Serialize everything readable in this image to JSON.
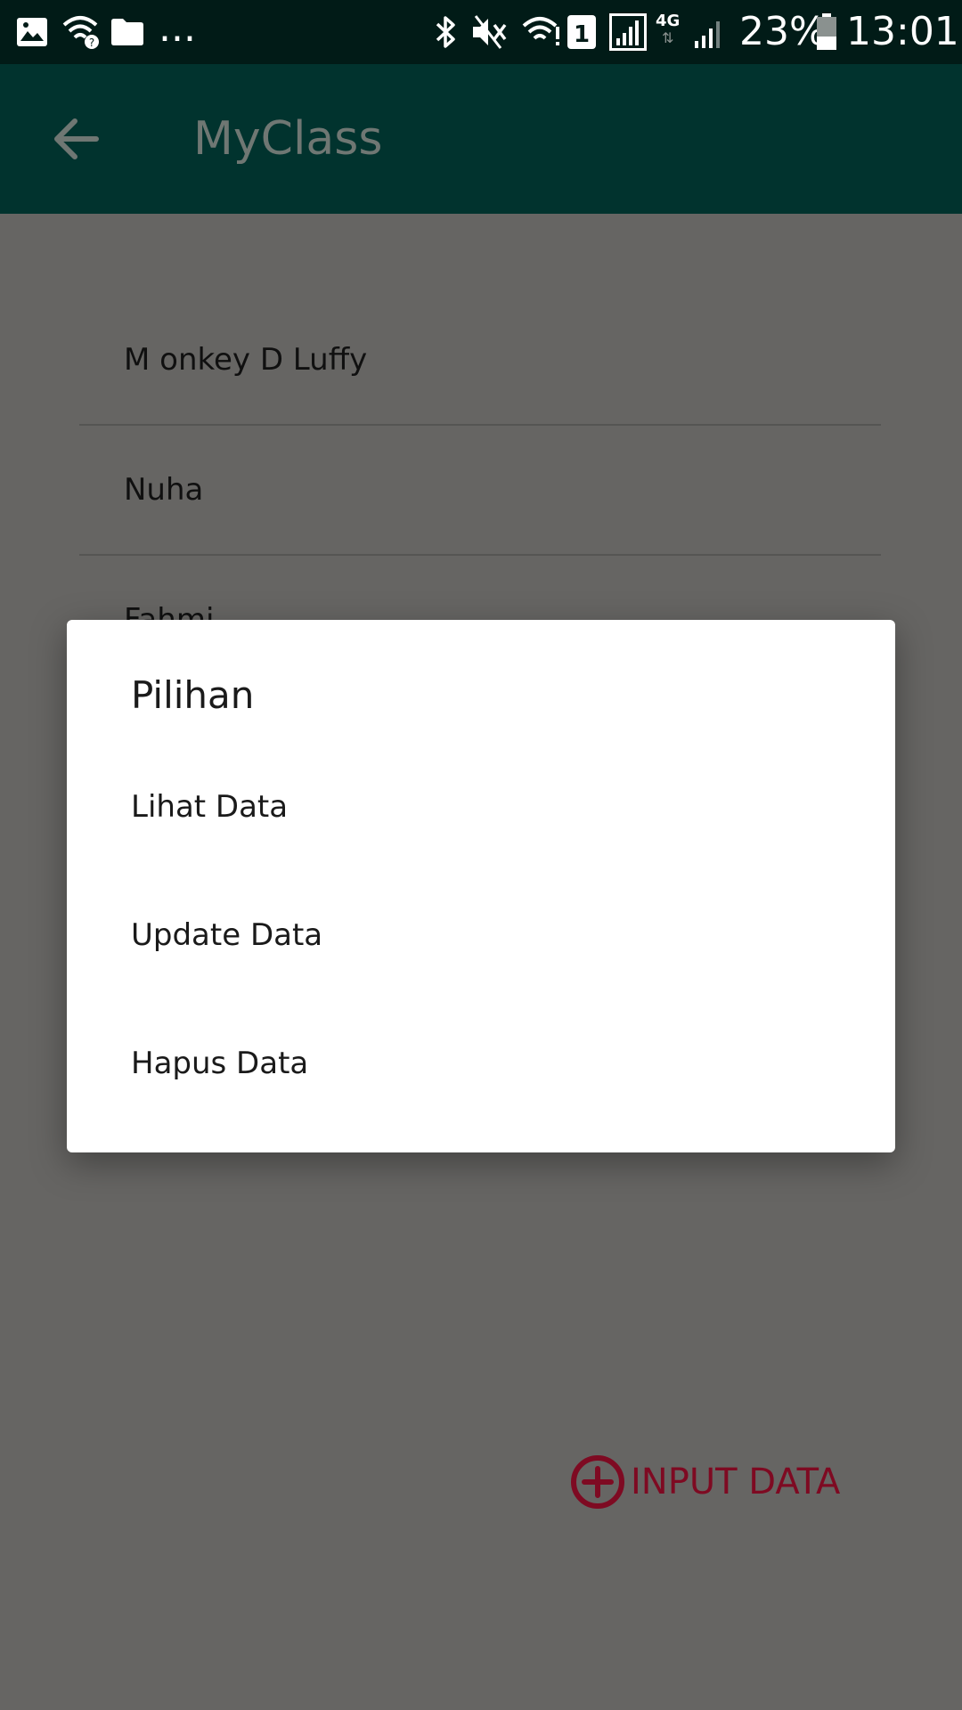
{
  "status_bar": {
    "battery": "23%",
    "time": "13:01",
    "overflow": "...",
    "network": "4G",
    "sim": "1",
    "icons": [
      "image-icon",
      "wifi-question-icon",
      "folder-icon",
      "bluetooth-icon",
      "mute-icon",
      "wifi-icon",
      "signal-icon",
      "battery-icon"
    ]
  },
  "app_bar": {
    "title": "MyClass"
  },
  "list": {
    "items": [
      {
        "name": "M onkey D Luffy"
      },
      {
        "name": "Nuha"
      },
      {
        "name": "Fahmi"
      }
    ]
  },
  "dialog": {
    "title": "Pilihan",
    "options": [
      {
        "label": "Lihat Data"
      },
      {
        "label": "Update Data"
      },
      {
        "label": "Hapus Data"
      }
    ]
  },
  "fab": {
    "label": "INPUT DATA",
    "icon": "add-circle-icon",
    "color": "#7e0a22"
  },
  "colors": {
    "status_bar": "#011b17",
    "app_bar": "#01332e",
    "scrim_background": "#666563",
    "dialog": "#ffffff"
  }
}
